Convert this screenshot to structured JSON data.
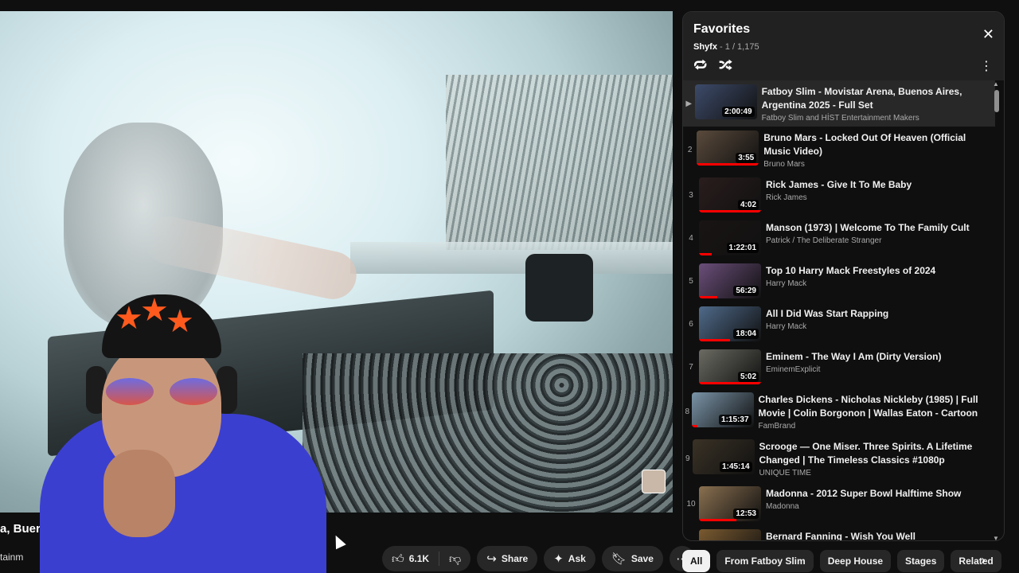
{
  "player": {
    "title_fragment": "a, Buer",
    "channel_fragment": "tainm"
  },
  "actions": {
    "likes": "6.1K",
    "share": "Share",
    "ask": "Ask",
    "save": "Save",
    "icons": [
      "thumb-up-icon",
      "thumb-down-icon",
      "share-icon",
      "sparkle-icon",
      "bookmark-icon",
      "more-horizontal-icon"
    ]
  },
  "playlist": {
    "title": "Favorites",
    "owner": "Shyfx",
    "position": "1 / 1,175",
    "items": [
      {
        "index": "▶",
        "title": "Fatboy Slim - Movistar Arena, Buenos Aires, Argentina 2025 - Full Set",
        "channel": "Fatboy Slim and HİST Entertainment Makers",
        "duration": "2:00:49",
        "thumb": "#3d4b6a",
        "progress": 0
      },
      {
        "index": "2",
        "title": "Bruno Mars - Locked Out Of Heaven (Official Music Video)",
        "channel": "Bruno Mars",
        "duration": "3:55",
        "thumb": "#5a4a3c",
        "progress": 1
      },
      {
        "index": "3",
        "title": "Rick James - Give It To Me Baby",
        "channel": "Rick James",
        "duration": "4:02",
        "thumb": "#2a1d1d",
        "progress": 1
      },
      {
        "index": "4",
        "title": "Manson (1973) | Welcome To The Family Cult",
        "channel": "Patrick / The Deliberate Stranger",
        "duration": "1:22:01",
        "thumb": "#1a1414",
        "progress": 0.2
      },
      {
        "index": "5",
        "title": "Top 10 Harry Mack Freestyles of 2024",
        "channel": "Harry Mack",
        "duration": "56:29",
        "thumb": "#6b4e7a",
        "progress": 0.3
      },
      {
        "index": "6",
        "title": "All I Did Was Start Rapping",
        "channel": "Harry Mack",
        "duration": "18:04",
        "thumb": "#4f6a8a",
        "progress": 0.5
      },
      {
        "index": "7",
        "title": "Eminem - The Way I Am (Dirty Version)",
        "channel": "EminemExplicit",
        "duration": "5:02",
        "thumb": "#6b6b63",
        "progress": 1
      },
      {
        "index": "8",
        "title": "Charles Dickens - Nicholas Nickleby (1985) | Full Movie | Colin Borgonon | Wallas Eaton - Cartoon",
        "channel": "FamBrand",
        "duration": "1:15:37",
        "thumb": "#7a94a8",
        "progress": 0.1
      },
      {
        "index": "9",
        "title": "Scrooge — One Miser. Three Spirits. A Lifetime Changed | The Timeless Classics #1080p",
        "channel": "UNIQUE TIME",
        "duration": "1:45:14",
        "thumb": "#3a3226",
        "progress": 0
      },
      {
        "index": "10",
        "title": "Madonna - 2012 Super Bowl Halftime Show",
        "channel": "Madonna",
        "duration": "12:53",
        "thumb": "#8a7050",
        "progress": 0.6
      },
      {
        "index": "",
        "title": "Bernard Fanning - Wish You Well",
        "channel": "",
        "duration": "",
        "thumb": "#7a5a30",
        "progress": 0
      }
    ]
  },
  "chips": [
    "All",
    "From Fatboy Slim",
    "Deep House",
    "Stages",
    "Related"
  ],
  "icons": {
    "close": "close-icon",
    "loop": "loop-icon",
    "shuffle": "shuffle-icon",
    "menu": "more-vertical-icon",
    "chip_next": "chevron-right-icon"
  }
}
